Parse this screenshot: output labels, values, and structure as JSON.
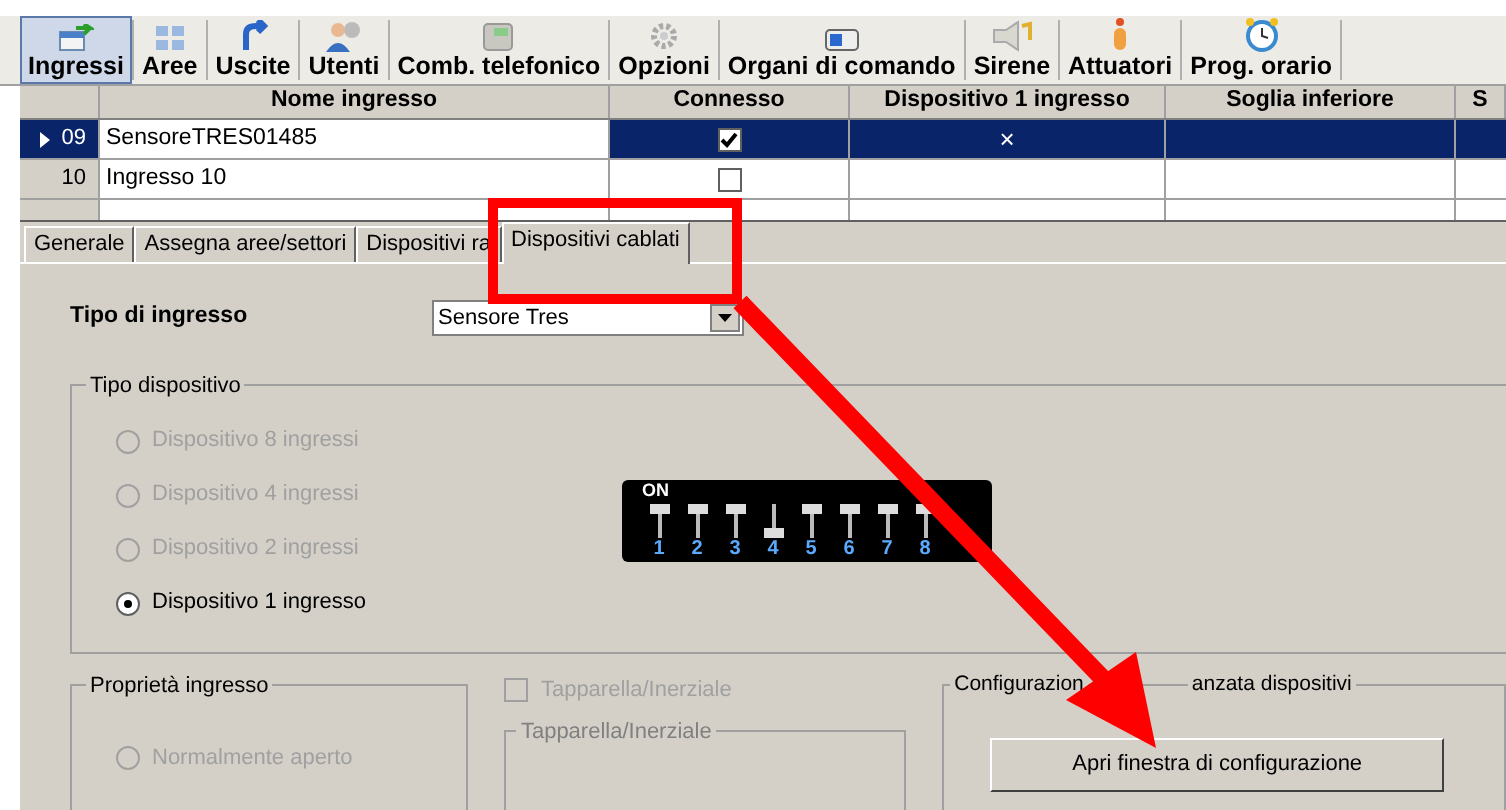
{
  "toolbar": [
    {
      "label": "Ingressi",
      "kind": "input",
      "selected": true
    },
    {
      "label": "Aree",
      "kind": "grid",
      "selected": false
    },
    {
      "label": "Uscite",
      "kind": "exit",
      "selected": false
    },
    {
      "label": "Utenti",
      "kind": "user",
      "selected": false
    },
    {
      "label": "Comb. telefonico",
      "kind": "phone",
      "selected": false
    },
    {
      "label": "Opzioni",
      "kind": "gear",
      "selected": false
    },
    {
      "label": "Organi di comando",
      "kind": "panel",
      "selected": false
    },
    {
      "label": "Sirene",
      "kind": "siren",
      "selected": false
    },
    {
      "label": "Attuatori",
      "kind": "hand",
      "selected": false
    },
    {
      "label": "Prog. orario",
      "kind": "clock",
      "selected": false
    }
  ],
  "table": {
    "columns": [
      "Nome ingresso",
      "Connesso",
      "Dispositivo 1 ingresso",
      "Soglia inferiore",
      "S"
    ],
    "rows": [
      {
        "number": "09",
        "name": "SensoreTRES01485",
        "connected": true,
        "device_1_input": "×",
        "selected": true
      },
      {
        "number": "10",
        "name": "Ingresso 10",
        "connected": false,
        "selected": false
      }
    ]
  },
  "tabs": [
    {
      "label": "Generale",
      "selected": false
    },
    {
      "label": "Assegna aree/settori",
      "selected": false
    },
    {
      "label": "Dispositivi ra",
      "selected": false
    },
    {
      "label": "Dispositivi cablati",
      "selected": true
    }
  ],
  "input_type": {
    "label": "Tipo di ingresso",
    "value": "Sensore Tres"
  },
  "device_type": {
    "title": "Tipo dispositivo",
    "options": [
      {
        "label": "Dispositivo 8 ingressi",
        "selected": false,
        "disabled": true
      },
      {
        "label": "Dispositivo 4 ingressi",
        "selected": false,
        "disabled": true
      },
      {
        "label": "Dispositivo 2 ingressi",
        "selected": false,
        "disabled": true
      },
      {
        "label": "Dispositivo 1 ingresso",
        "selected": true,
        "disabled": false
      }
    ],
    "dip_switch": {
      "on_label": "ON",
      "switches": [
        {
          "label": "1",
          "on": true
        },
        {
          "label": "2",
          "on": true
        },
        {
          "label": "3",
          "on": true
        },
        {
          "label": "4",
          "on": false
        },
        {
          "label": "5",
          "on": true
        },
        {
          "label": "6",
          "on": true
        },
        {
          "label": "7",
          "on": true
        },
        {
          "label": "8",
          "on": true
        }
      ]
    }
  },
  "input_properties": {
    "title": "Proprietà ingresso",
    "options": [
      {
        "label": "Normalmente aperto",
        "selected": false,
        "disabled": true
      }
    ]
  },
  "shutter": {
    "label": "Tapparella/Inerziale",
    "checked": false,
    "disabled": true,
    "group_title": "Tapparella/Inerziale"
  },
  "advanced_config": {
    "title_parts": [
      "Configurazion",
      "anzata dispositivi"
    ],
    "button": "Apri finestra di configurazione"
  }
}
